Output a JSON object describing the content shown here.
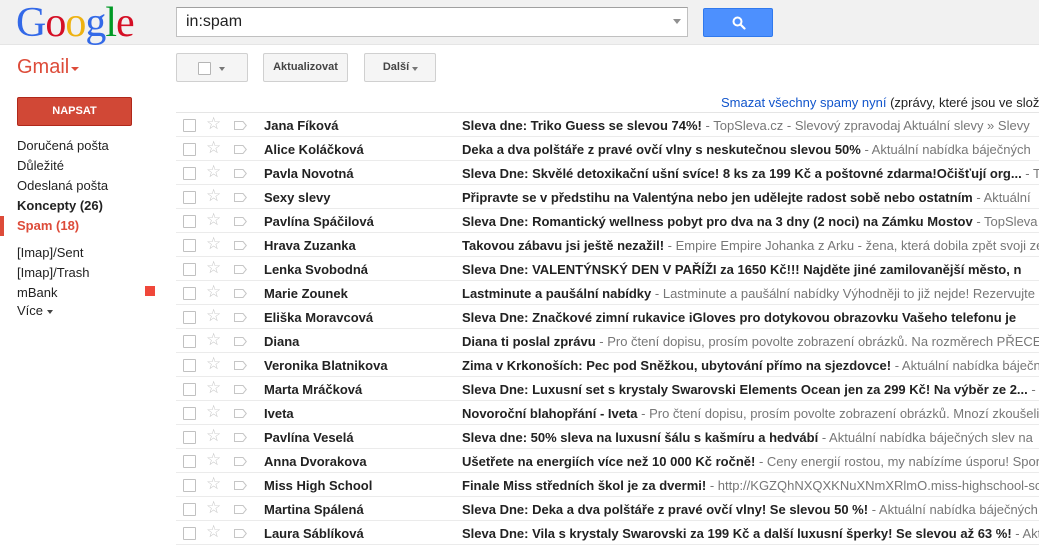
{
  "header": {
    "logo_letters": [
      {
        "ch": "G",
        "color": "#3369e8"
      },
      {
        "ch": "o",
        "color": "#d50f25"
      },
      {
        "ch": "o",
        "color": "#eeb211"
      },
      {
        "ch": "g",
        "color": "#3369e8"
      },
      {
        "ch": "l",
        "color": "#009925"
      },
      {
        "ch": "e",
        "color": "#d50f25"
      }
    ],
    "search_value": "in:spam",
    "search_button_icon": "search-icon"
  },
  "toolbar": {
    "app_label": "Gmail",
    "refresh_label": "Aktualizovat",
    "more_label": "Další"
  },
  "sidebar": {
    "compose_label": "NAPSAT",
    "items": [
      {
        "label": "Doručená pošta",
        "style": "normal"
      },
      {
        "label": "Důležité",
        "style": "normal"
      },
      {
        "label": "Odeslaná pošta",
        "style": "normal"
      },
      {
        "label": "Koncepty (26)",
        "style": "bold"
      },
      {
        "label": "Spam (18)",
        "style": "active"
      },
      {
        "label": "[Imap]/Sent",
        "style": "normal"
      },
      {
        "label": "[Imap]/Trash",
        "style": "normal"
      },
      {
        "label": "mBank",
        "style": "normal",
        "label_color": "#f0473a"
      },
      {
        "label": "Více",
        "style": "normal"
      }
    ]
  },
  "notice": {
    "link": "Smazat všechny spamy nyní",
    "text": " (zprávy, které jsou ve složce"
  },
  "messages": [
    {
      "sender": "Jana Fíková",
      "subject": "Sleva dne: Triko Guess se slevou 74%!",
      "snippet": " - TopSleva.cz - Slevový zpravodaj Aktuální slevy » Slevy"
    },
    {
      "sender": "Alice Koláčková",
      "subject": "Deka a dva polštáře z pravé ovčí vlny s neskutečnou slevou 50%",
      "snippet": " - Aktuální nabídka báječných"
    },
    {
      "sender": "Pavla Novotná",
      "subject": "Sleva Dne: Skvělé detoxikační ušní svíce! 8 ks za 199 Kč a poštovné zdarma!Očišťují org...",
      "snippet": " - TopSleva"
    },
    {
      "sender": "Sexy slevy",
      "subject": "Připravte se v předstihu na Valentýna nebo jen udělejte radost sobě nebo ostatním",
      "snippet": " - Aktuální"
    },
    {
      "sender": "Pavlína Spáčilová",
      "subject": "Sleva Dne: Romantický wellness pobyt pro dva na 3 dny (2 noci) na Zámku Mostov",
      "snippet": " - TopSleva"
    },
    {
      "sender": "Hrava Zuzanka",
      "subject": "Takovou zábavu jsi ještě nezažil!",
      "snippet": " - Empire Empire Johanka z Arku - žena, která dobila zpět svoji zemi"
    },
    {
      "sender": "Lenka Svobodná",
      "subject": "Sleva Dne: VALENTÝNSKÝ DEN V PAŘÍŽI za 1650 Kč!!! Najděte jiné zamilovanější město, n",
      "snippet": ""
    },
    {
      "sender": "Marie Zounek",
      "subject": "Lastminute a paušální nabídky",
      "snippet": " - Lastminute a paušální nabídky Výhodněji to již nejde! Rezervujte"
    },
    {
      "sender": "Eliška Moravcová",
      "subject": "Sleva Dne: Značkové zimní rukavice iGloves pro dotykovou obrazovku Vašeho telefonu je",
      "snippet": ""
    },
    {
      "sender": "Diana",
      "subject": "Diana ti poslal zprávu",
      "snippet": " - Pro čtení dopisu, prosím povolte zobrazení obrázků. Na rozměrech PŘECE"
    },
    {
      "sender": "Veronika Blatnikova",
      "subject": "Zima v Krkonoších: Pec pod Sněžkou, ubytování přímo na sjezdovce!",
      "snippet": " - Aktuální nabídka báječných"
    },
    {
      "sender": "Marta Mráčková",
      "subject": "Sleva Dne: Luxusní set s krystaly Swarovski Elements Ocean jen za 299 Kč! Na výběr ze 2...",
      "snippet": " -"
    },
    {
      "sender": "Iveta",
      "subject": "Novoroční blahopřání - Iveta",
      "snippet": " - Pro čtení dopisu, prosím povolte zobrazení obrázků. Mnozí zkoušeli"
    },
    {
      "sender": "Pavlína Veselá",
      "subject": "Sleva dne: 50% sleva na luxusní šálu s kašmíru a hedvábí",
      "snippet": " - Aktuální nabídka báječných slev na"
    },
    {
      "sender": "Anna Dvorakova",
      "subject": "Ušetřete na energiích více než 10 000 Kč ročně!",
      "snippet": " - Ceny energií rostou, my nabízíme úsporu! Sporo"
    },
    {
      "sender": "Miss High School",
      "subject": "Finale Miss středních škol je za dvermi!",
      "snippet": " - http://KGZQhNXQXKNuXNmXRlmO.miss-highschool-sc"
    },
    {
      "sender": "Martina Spálená",
      "subject": "Sleva Dne: Deka a dva polštáře z pravé ovčí vlny! Se slevou 50 %!",
      "snippet": " - Aktuální nabídka báječných"
    },
    {
      "sender": "Laura Sáblíková",
      "subject": "Sleva Dne: Vila s krystaly Swarovski za 199 Kč a další luxusní šperky! Se slevou až 63 %!",
      "snippet": " - Aktu"
    }
  ]
}
